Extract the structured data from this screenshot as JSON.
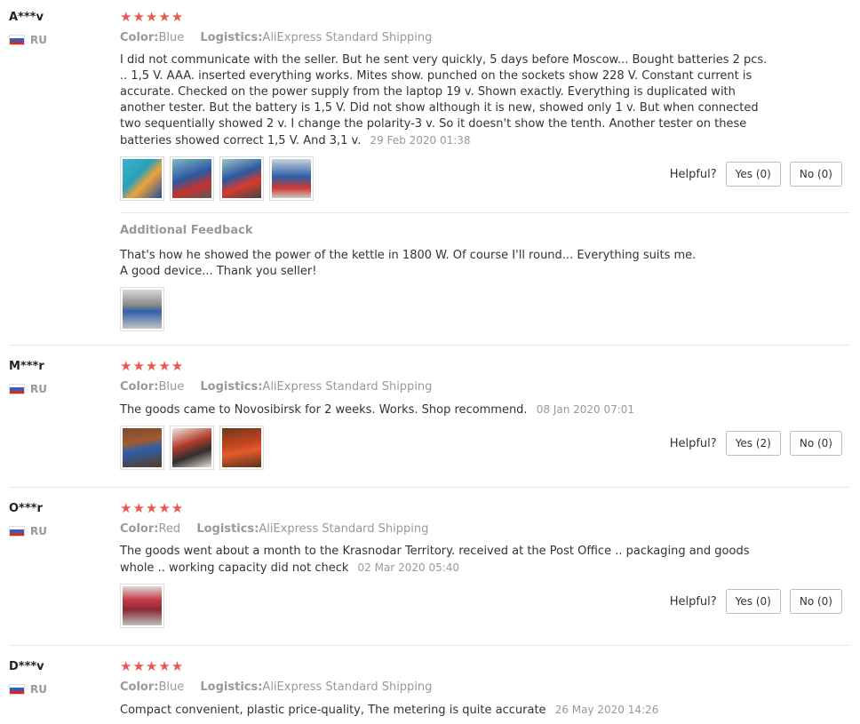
{
  "labels": {
    "color_key": "Color:",
    "logistics_key": "Logistics:",
    "helpful": "Helpful?",
    "additional_feedback": "Additional Feedback"
  },
  "colors": {
    "star": "#e85a4f"
  },
  "reviews": [
    {
      "user": "A***v",
      "country": "RU",
      "stars": "★★★★★",
      "color": "Blue",
      "logistics": "AliExpress Standard Shipping",
      "text": "I did not communicate with the seller. But he sent very quickly, 5 days before Moscow... Bought batteries 2 pcs. .. 1,5 V. AAA. inserted everything works. Mites show. punched on the sockets show 228 V. Constant current is accurate. Checked on the power supply from the laptop 19 v. Shown exactly. Everything is duplicated with another tester. But the battery is 1,5 V. Did not show although it is new, showed only 1 v. But when connected two sequentially showed 2 v. I change the polarity-3 v. So it doesn't show the tenth. Another tester on these batteries showed correct 1,5 V. And 3,1 v.",
      "date": "29 Feb 2020 01:38",
      "yes": "Yes (0)",
      "no": "No (0)",
      "additional_text": "That's how he showed the power of the kettle in 1800 W. Of course I'll round... Everything suits me. A good device... Thank you seller!"
    },
    {
      "user": "M***r",
      "country": "RU",
      "stars": "★★★★★",
      "color": "Blue",
      "logistics": "AliExpress Standard Shipping",
      "text": "The goods came to Novosibirsk for 2 weeks. Works. Shop recommend.",
      "date": "08 Jan 2020 07:01",
      "yes": "Yes (2)",
      "no": "No (0)"
    },
    {
      "user": "O***r",
      "country": "RU",
      "stars": "★★★★★",
      "color": "Red",
      "logistics": "AliExpress Standard Shipping",
      "text": "The goods went about a month to the Krasnodar Territory. received at the Post Office .. packaging and goods whole .. working capacity did not check",
      "date": "02 Mar 2020 05:40",
      "yes": "Yes (0)",
      "no": "No (0)"
    },
    {
      "user": "D***v",
      "country": "RU",
      "stars": "★★★★★",
      "color": "Blue",
      "logistics": "AliExpress Standard Shipping",
      "text": "Compact convenient, plastic price-quality, The metering is quite accurate",
      "date": "26 May 2020 14:26"
    }
  ]
}
